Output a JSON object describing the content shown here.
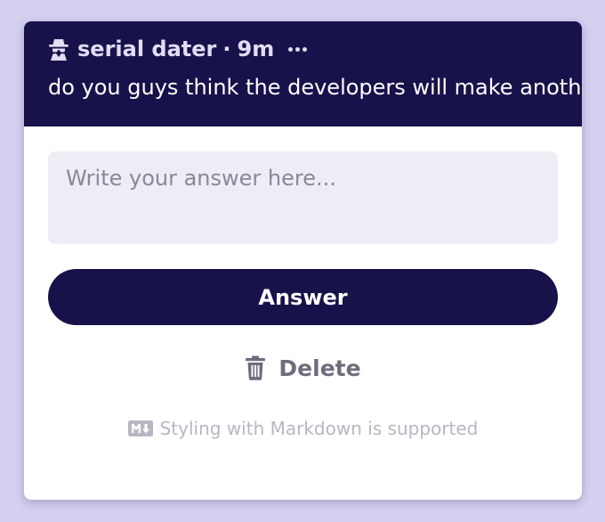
{
  "post": {
    "author": "serial dater",
    "separator": "·",
    "time_ago": "9m",
    "question": "do you guys think the developers will make another Q&A at the end of the game?"
  },
  "answer_form": {
    "placeholder": "Write your answer here...",
    "value": "",
    "submit_label": "Answer"
  },
  "actions": {
    "delete_label": "Delete"
  },
  "footer": {
    "markdown_note": "Styling with Markdown is supported"
  },
  "icons": {
    "author": "spy-icon",
    "more": "more-horizontal-icon",
    "delete": "trash-icon",
    "markdown": "markdown-icon"
  },
  "colors": {
    "background": "#d4d0f0",
    "header": "#18124a",
    "input_background": "#eeecf5",
    "button": "#18124a",
    "delete_text": "#6f6d7c",
    "muted_text": "#b8b6c2"
  }
}
